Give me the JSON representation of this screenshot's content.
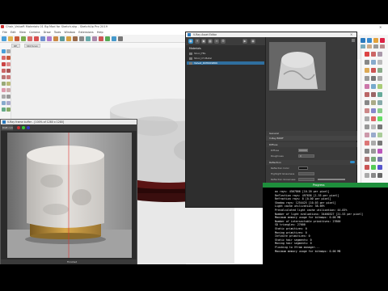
{
  "app": {
    "title": "Chair_ValueR Materials 01 Bg Mod for Sketch.skp - SketchUp Pro 2019"
  },
  "menu": [
    "File",
    "Edit",
    "View",
    "Camera",
    "Draw",
    "Tools",
    "Window",
    "Extensions",
    "Help"
  ],
  "tabs": [
    "RE_",
    "Still Scan"
  ],
  "colors": {
    "vray_accent": "#2f8fcc",
    "progress_header": "#1e8f3c"
  },
  "tray": {
    "rows": [
      "Instr",
      "Styles",
      "Layers"
    ]
  },
  "vfb": {
    "title": "V-Ray frame buffer - [100% of 1280 x 1280]",
    "channel": "RGB color",
    "status": "Finished"
  },
  "asset_editor": {
    "title": "V-Ray Asset Editor",
    "list_header": "Materials",
    "materials": [
      "Stool_FBL",
      "Stool_CY-Metal",
      "Velvet_R0HO09869"
    ],
    "general_label": "General",
    "brdf_label": "V-Ray BRDF",
    "diffuse_section": "Diffuse",
    "diffuse_rows": [
      "Diffuse",
      "Roughness"
    ],
    "reflection_section": "Reflection",
    "reflection_rows": [
      "Reflection Color",
      "Highlight Glossiness",
      "Reflection Glossiness",
      "Fresnel",
      "Reflection IOR",
      "BRDF",
      "Back Side Reflect"
    ],
    "roughness_value": "0",
    "brdf_value": "GGX"
  },
  "progress": {
    "header": "Progress",
    "lines": [
      "   ax rays: 4567866 [10.20 per pixel]",
      "   Reflection rays: 497636 [1.55 per pixel]",
      "   Refraction rays: 8 [0.00 per pixel]",
      "   Shadow rays: 1254425 [10.03 per pixel]",
      "   Light cache utilization: 38.69%",
      "   Precalculated light cache utilization: 44.83%",
      "   Number of light evaluations: 34460327 [21.53 per pixel]",
      "   Maximum memory usage for bitmaps: 0.00 MB",
      "   Number of intersectable primitives: 27600",
      "     SD triangles: 27600",
      "     Static primitives: 0",
      "     Moving primitives: 0",
      "     Infinite primitives: 0",
      "     Static hair segments: 0",
      "     Moving hair segments: 0",
      "   Flushing to Vfram manager...",
      "   Maximum memory usage for bitmaps: 0.00 MB"
    ]
  }
}
